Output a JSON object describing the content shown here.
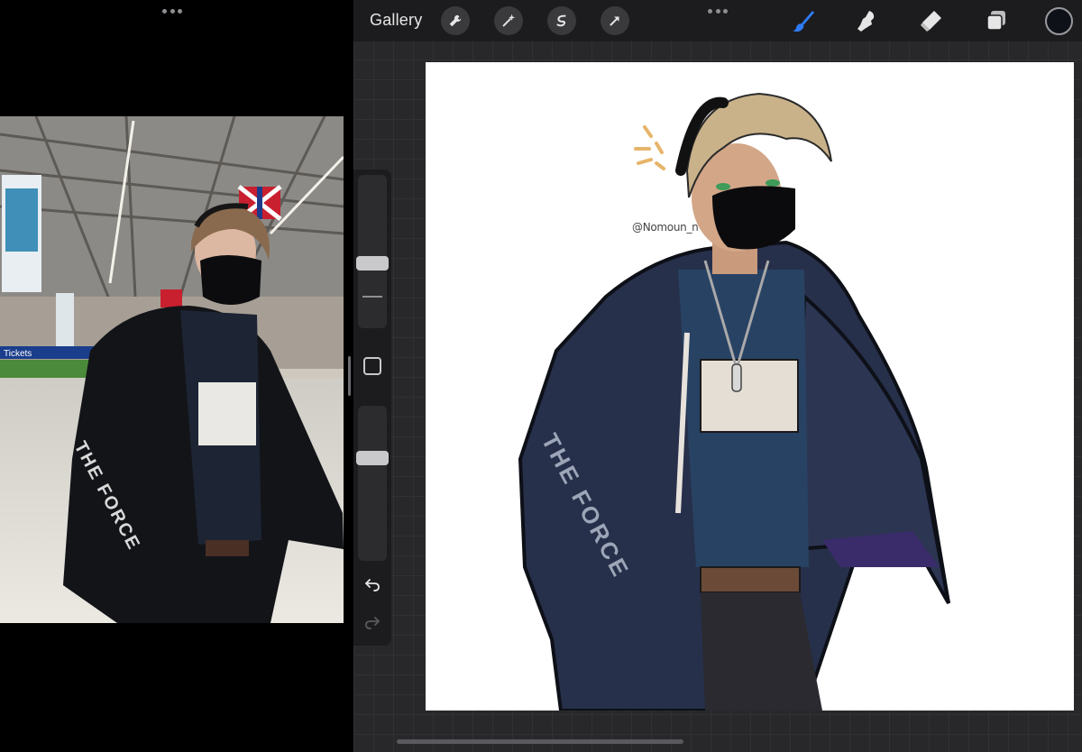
{
  "toolbar": {
    "gallery_label": "Gallery",
    "actions": [
      {
        "icon": "wrench-icon"
      },
      {
        "icon": "magic-wand-icon"
      },
      {
        "icon": "selection-icon"
      },
      {
        "icon": "transform-arrow-icon"
      }
    ],
    "tools": [
      {
        "icon": "brush-icon",
        "active": true,
        "color": "#2f7bf6"
      },
      {
        "icon": "smudge-icon",
        "active": false,
        "color": "#e6e6e6"
      },
      {
        "icon": "eraser-icon",
        "active": false,
        "color": "#e6e6e6"
      },
      {
        "icon": "layers-icon",
        "active": false,
        "color": "#e6e6e6"
      }
    ],
    "current_color": "#0f1118"
  },
  "canvas": {
    "signature": "@Nomoun_n",
    "background": "#ffffff"
  },
  "reference_photo": {
    "banner_text": "Tickets",
    "sleeve_text": "THE FORCE"
  },
  "artwork": {
    "sleeve_text": "THE FORCE"
  }
}
